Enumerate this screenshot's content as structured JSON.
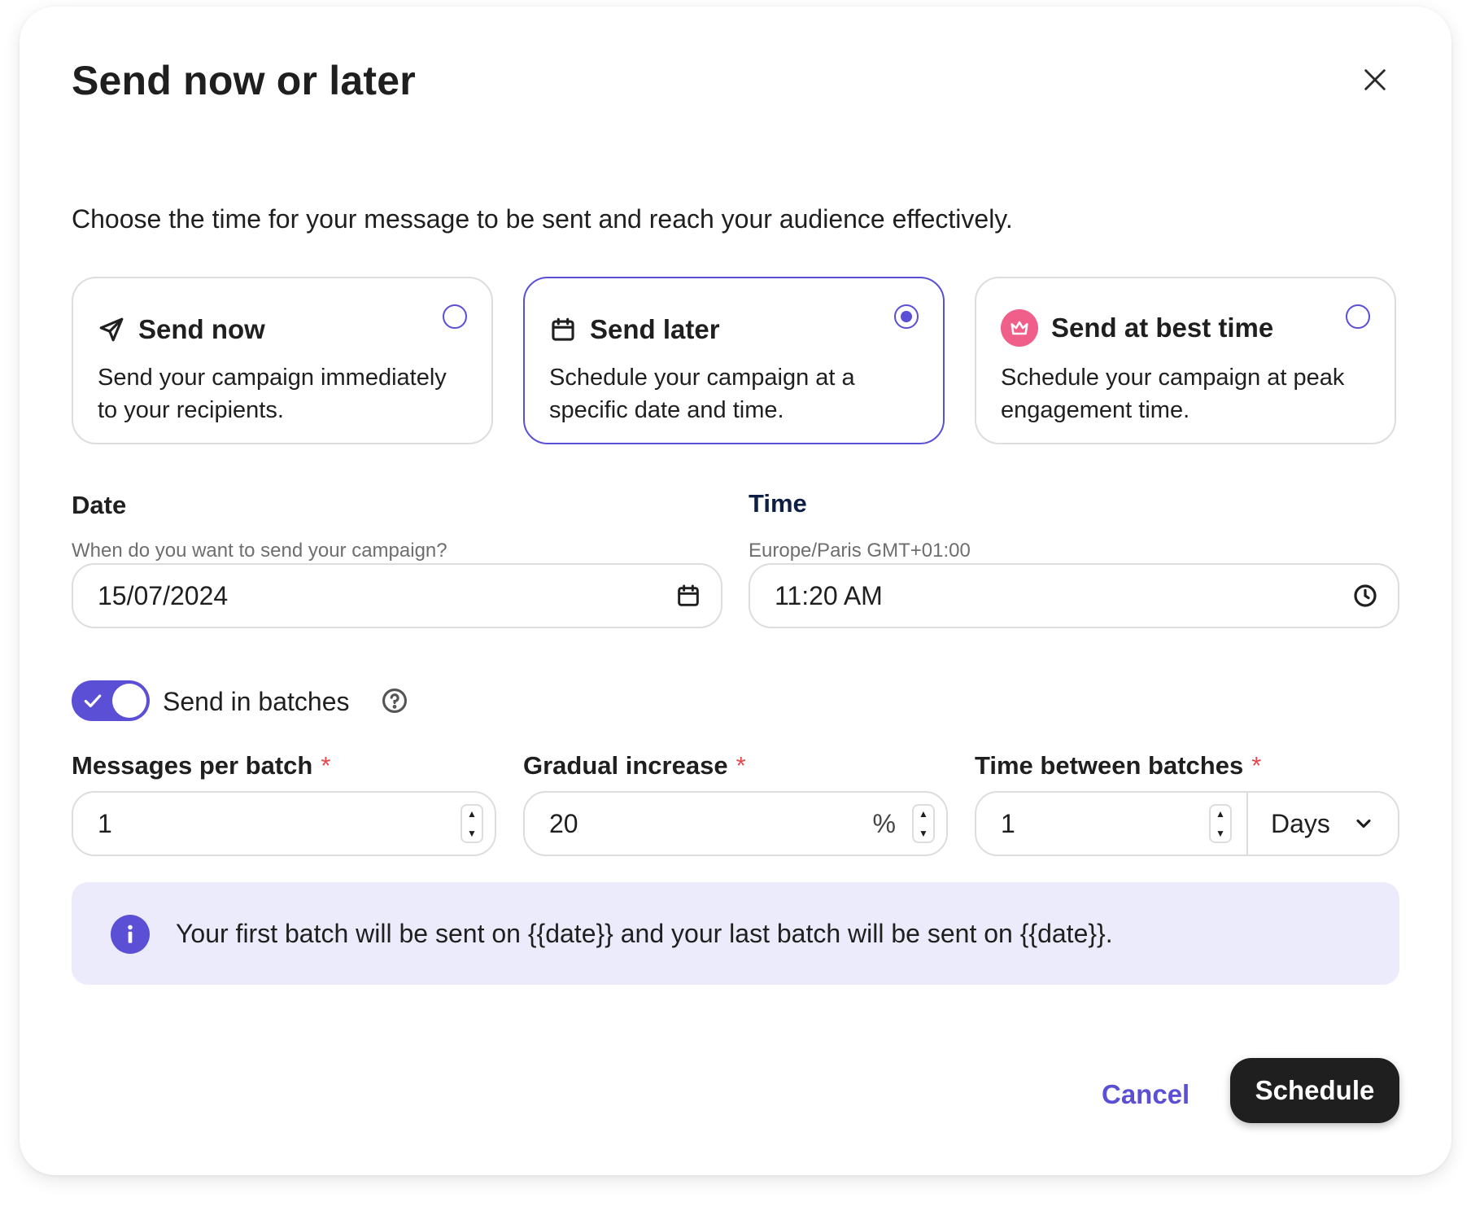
{
  "modal": {
    "title": "Send now or later",
    "description": "Choose the time for your message to be sent and reach your audience effectively."
  },
  "options": [
    {
      "title": "Send now",
      "description": "Send your campaign immediately to your recipients.",
      "icon": "send-icon",
      "selected": false
    },
    {
      "title": "Send later",
      "description": "Schedule your campaign at a specific date and time.",
      "icon": "calendar-icon",
      "selected": true
    },
    {
      "title": "Send at best time",
      "description": "Schedule your campaign at peak engagement time.",
      "icon": "crown-icon",
      "selected": false
    }
  ],
  "date": {
    "label": "Date",
    "hint": "When do you want to send your campaign?",
    "value": "15/07/2024"
  },
  "time": {
    "label": "Time",
    "hint": "Europe/Paris GMT+01:00",
    "value": "11:20 AM"
  },
  "batches": {
    "toggle_label": "Send in batches",
    "enabled": true,
    "messages_per_batch": {
      "label": "Messages per batch",
      "required_mark": "*",
      "value": "1"
    },
    "gradual_increase": {
      "label": "Gradual increase",
      "required_mark": "*",
      "value": "20",
      "unit": "%"
    },
    "time_between": {
      "label": "Time between batches",
      "required_mark": "*",
      "value": "1",
      "unit": "Days"
    }
  },
  "info_banner": {
    "text": "Your first batch will be sent on {{date}} and your last batch will be sent on {{date}}."
  },
  "footer": {
    "cancel_label": "Cancel",
    "schedule_label": "Schedule"
  },
  "colors": {
    "accent": "#5b4fd6",
    "required": "#e5484d",
    "banner_bg": "#ecebfb",
    "crown_bg": "#ef5f8a",
    "primary_button": "#1f1f1f"
  }
}
